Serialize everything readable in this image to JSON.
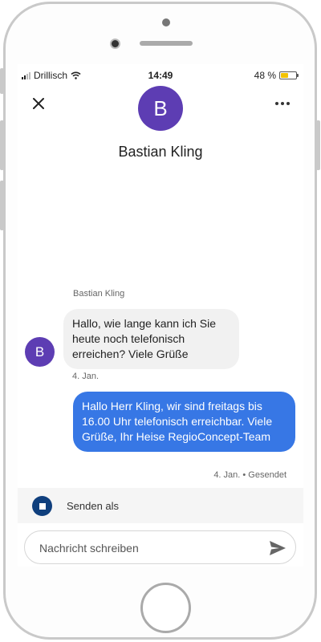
{
  "status_bar": {
    "carrier": "Drillisch",
    "time": "14:49",
    "battery": "48 %",
    "battery_level": 0.48
  },
  "header": {
    "avatar_initial": "B",
    "contact_name": "Bastian Kling"
  },
  "conversation": {
    "sender_label": "Bastian Kling",
    "incoming": {
      "avatar_initial": "B",
      "text": "Hallo, wie lange kann ich Sie heute noch telefonisch erreichen? Viele Grüße",
      "date": "4. Jan."
    },
    "outgoing": {
      "text": "Hallo Herr Kling, wir sind freitags bis 16.00 Uhr telefonisch erreichbar. Viele Grüße, Ihr Heise RegioConcept-Team",
      "status": "4. Jan. • Gesendet"
    }
  },
  "send_as": {
    "label": "Senden als"
  },
  "compose": {
    "placeholder": "Nachricht schreiben"
  },
  "colors": {
    "avatar": "#5d3db3",
    "outgoing_bubble": "#3777e5",
    "incoming_bubble": "#f1f1f1",
    "battery": "#f3c200"
  },
  "icons": {
    "close": "close-icon",
    "more": "more-options-icon",
    "send": "send-icon",
    "wifi": "wifi-icon",
    "logo": "heise-logo-icon"
  }
}
